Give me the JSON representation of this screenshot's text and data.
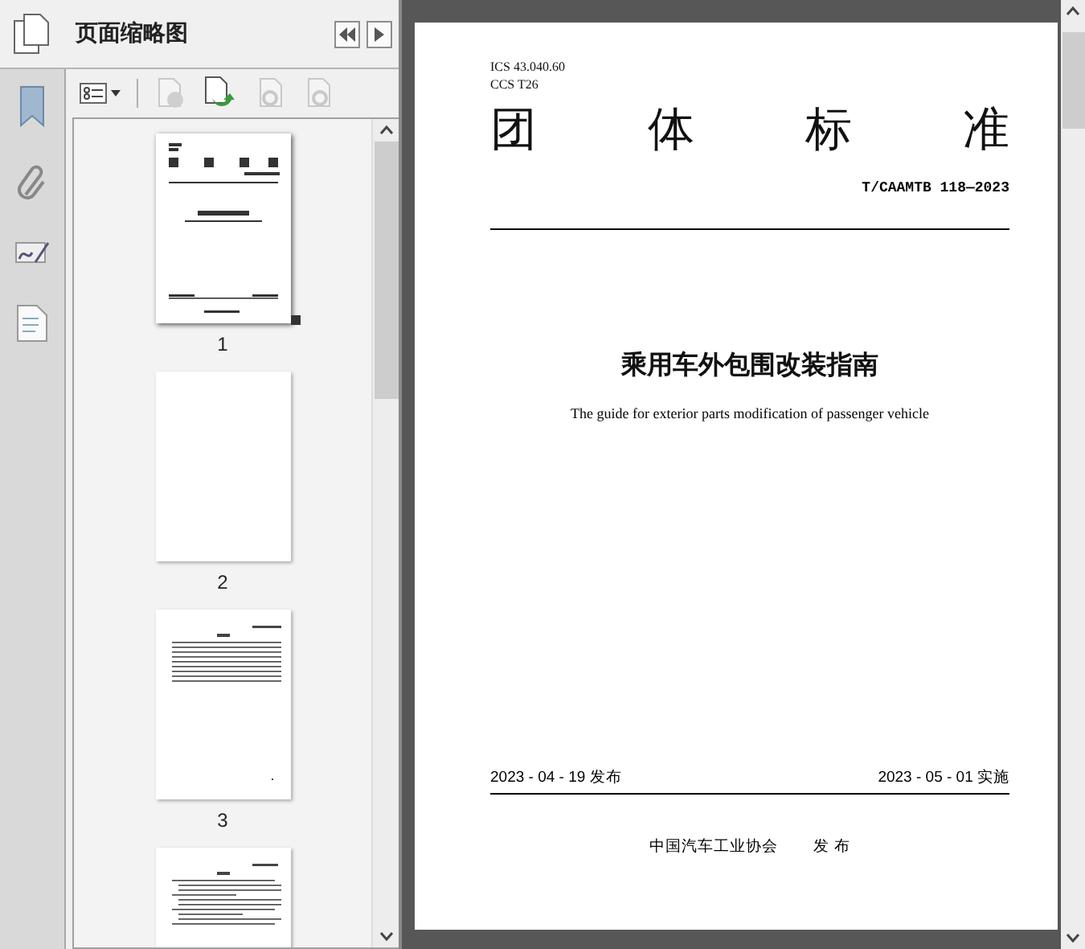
{
  "panel": {
    "title": "页面缩略图"
  },
  "thumbnails": [
    {
      "label": "1",
      "kind": "cover",
      "selected": true
    },
    {
      "label": "2",
      "kind": "blank",
      "selected": false
    },
    {
      "label": "3",
      "kind": "contents",
      "selected": false
    },
    {
      "kind": "text",
      "selected": false
    }
  ],
  "document": {
    "ics": "ICS  43.040.60",
    "ccs": "CCS  T26",
    "heading": [
      "团",
      "体",
      "标",
      "准"
    ],
    "number": "T/CAAMTB 118—2023",
    "title": "乘用车外包围改装指南",
    "subtitle": "The guide for exterior parts modification of passenger vehicle",
    "issued": "2023 - 04 - 19 发布",
    "effective": "2023 - 05 - 01 实施",
    "publisher": "中国汽车工业协会",
    "publish_word": "发 布"
  }
}
